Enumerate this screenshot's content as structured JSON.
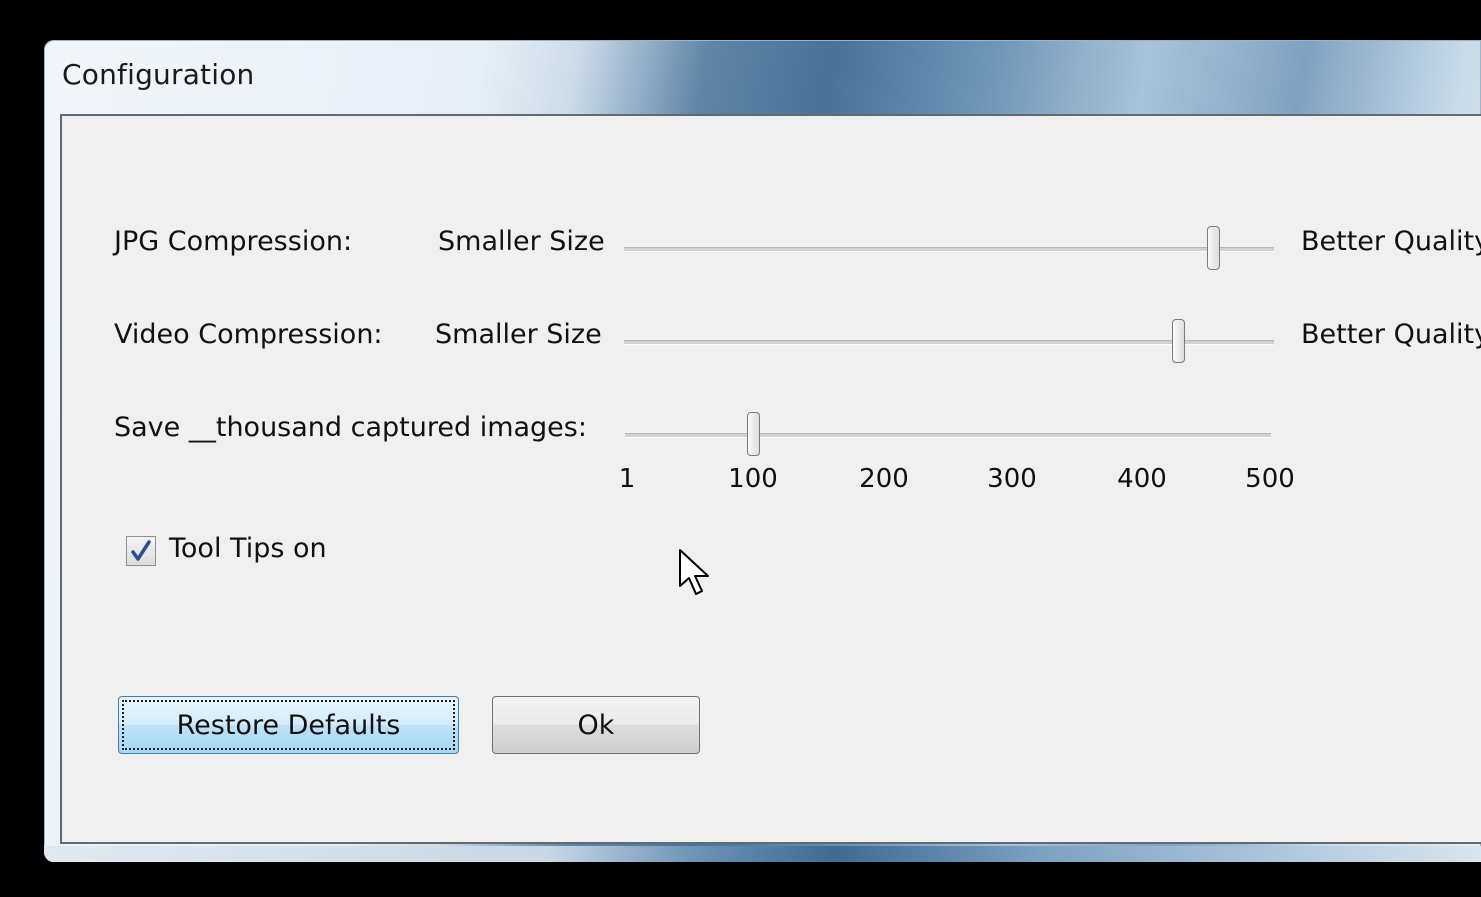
{
  "window": {
    "title": "Configuration"
  },
  "settings": {
    "jpg": {
      "label": "JPG Compression:",
      "min_label": "Smaller Size",
      "max_label": "Better Quality",
      "value_fraction": 0.906
    },
    "video": {
      "label": "Video Compression:",
      "min_label": "Smaller Size",
      "max_label": "Better Quality",
      "value_fraction": 0.853
    },
    "save": {
      "label": "Save __thousand captured images:",
      "ticks": [
        "1",
        "100",
        "200",
        "300",
        "400",
        "500"
      ],
      "value": 100
    }
  },
  "tooltips": {
    "label": "Tool Tips on",
    "checked": true
  },
  "buttons": {
    "restore": "Restore Defaults",
    "ok": "Ok"
  },
  "colors": {
    "dialog_background": "#f0f0f0",
    "checkmark": "#2c4f8f",
    "focused_button": "#bfe2f8"
  }
}
